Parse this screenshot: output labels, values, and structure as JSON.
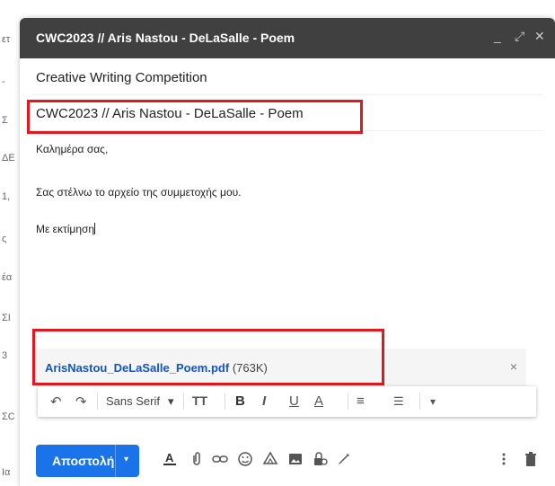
{
  "left_strip": {
    "chars": [
      "ετ",
      "-",
      "Σ",
      "ΔΕ",
      "1,",
      "ς",
      "έα",
      "ΣΙ",
      "3",
      "ΣC",
      "Ια"
    ]
  },
  "compose": {
    "title": "CWC2023 // Aris Nastou - DeLaSalle - Poem",
    "controls": {
      "minimize": "_",
      "expand": "⤢",
      "close": "✕"
    },
    "recipients": "Creative Writing Competition",
    "subject": "CWC2023 // Aris Nastou - DeLaSalle - Poem",
    "body": {
      "greeting": "Καλημέρα σας,",
      "line": "Σας στέλνω το αρχείο της συμμετοχής μου.",
      "closing": "Με εκτίμηση"
    },
    "attachment": {
      "filename": "ArisNastou_DeLaSalle_Poem.pdf",
      "size": "(763K)",
      "remove": "×"
    },
    "formatting": {
      "undo": "↶",
      "redo": "↷",
      "font": "Sans Serif",
      "font_caret": "▾",
      "size_icon": "TT",
      "bold": "B",
      "italic": "I",
      "underline": "U",
      "text_color": "A",
      "align": "≡",
      "list": "☰",
      "more": "▾"
    },
    "send": {
      "label": "Αποστολή",
      "menu": "▾"
    },
    "colors": {
      "titlebar": "#404040",
      "send": "#1a73e8",
      "highlight": "#e2181e",
      "link": "#1155cc"
    }
  }
}
